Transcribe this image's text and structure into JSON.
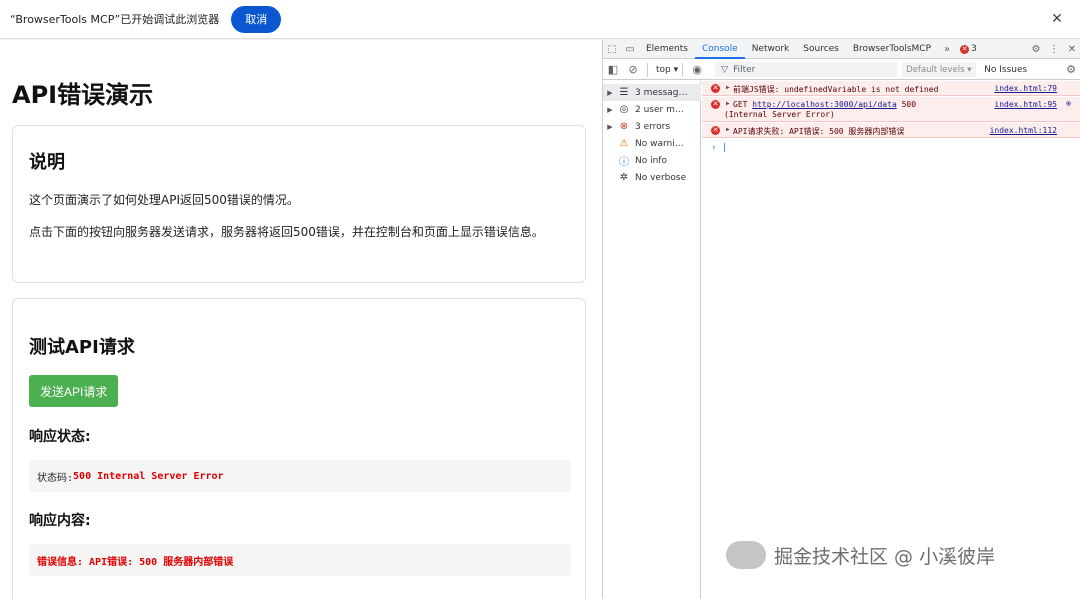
{
  "infobar": {
    "message": "“BrowserTools MCP”已开始调试此浏览器",
    "cancel_label": "取消",
    "close_icon": "close-icon"
  },
  "page": {
    "title": "API错误演示",
    "explain": {
      "heading": "说明",
      "para1": "这个页面演示了如何处理API返回500错误的情况。",
      "para2": "点击下面的按钮向服务器发送请求，服务器将返回500错误，并在控制台和页面上显示错误信息。"
    },
    "test": {
      "heading": "测试API请求",
      "button_label": "发送API请求",
      "status_heading": "响应状态:",
      "status_prefix": "状态码: ",
      "status_value": "500 Internal Server Error",
      "content_heading": "响应内容:",
      "content_value": "错误信息: API错误: 500 服务器内部错误"
    }
  },
  "devtools": {
    "tabs": [
      "Elements",
      "Console",
      "Network",
      "Sources",
      "BrowserToolsMCP"
    ],
    "active_tab": "Console",
    "error_count": "3",
    "toolbar": {
      "context": "top",
      "filter_placeholder": "Filter",
      "levels": "Default levels",
      "issues": "No Issues"
    },
    "sidebar": [
      {
        "label": "3 messag…",
        "icon": "list-icon"
      },
      {
        "label": "2 user m…",
        "icon": "user-icon"
      },
      {
        "label": "3 errors",
        "icon": "error-icon"
      },
      {
        "label": "No warni…",
        "icon": "warning-icon"
      },
      {
        "label": "No info",
        "icon": "info-icon"
      },
      {
        "label": "No verbose",
        "icon": "bug-icon"
      }
    ],
    "messages": [
      {
        "text": "前端JS错误: undefinedVariable is not defined",
        "source": "index.html:79"
      },
      {
        "text_prefix": "GET ",
        "url": "http://localhost:3000/api/data",
        "text_suffix": " 500",
        "line2": "(Internal Server Error)",
        "source": "index.html:95"
      },
      {
        "text": "API请求失败: API错误: 500 服务器内部错误",
        "source": "index.html:112"
      }
    ]
  },
  "watermark": {
    "text": "掘金技术社区 @ 小溪彼岸"
  },
  "colors": {
    "primary_button": "#0b57d0",
    "send_button": "#4caf50",
    "error_red": "#e00000",
    "devtools_accent": "#1a73e8"
  }
}
